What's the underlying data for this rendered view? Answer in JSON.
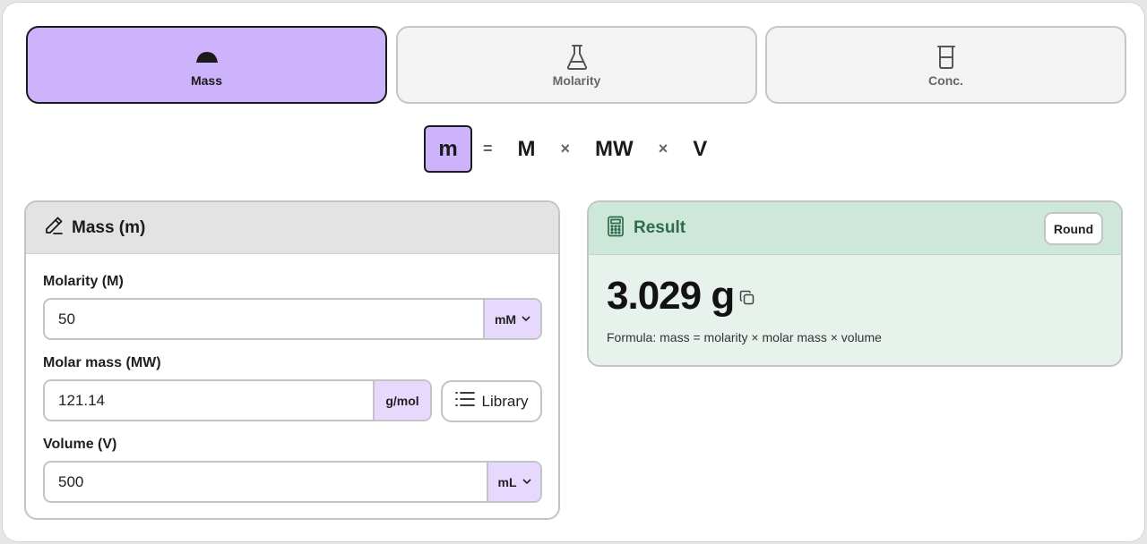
{
  "tabs": [
    {
      "label": "Mass",
      "icon": "mass-icon",
      "active": true
    },
    {
      "label": "Molarity",
      "icon": "flask-icon",
      "active": false
    },
    {
      "label": "Conc.",
      "icon": "beaker-icon",
      "active": false
    }
  ],
  "formula": {
    "lhs": "m",
    "eq": "=",
    "a": "M",
    "times1": "×",
    "b": "MW",
    "times2": "×",
    "c": "V"
  },
  "inputs": {
    "title": "Mass (m)",
    "molarity": {
      "label": "Molarity (M)",
      "value": "50",
      "unit": "mM"
    },
    "molar_mass": {
      "label": "Molar mass (MW)",
      "value": "121.14",
      "unit": "g/mol"
    },
    "library_label": "Library",
    "volume": {
      "label": "Volume (V)",
      "value": "500",
      "unit": "mL"
    }
  },
  "result": {
    "title": "Result",
    "round_label": "Round",
    "value": "3.029 g",
    "formula": "Formula: mass = molarity × molar mass × volume"
  },
  "colors": {
    "accent": "#cdb3fb",
    "unit_bg": "#e6d9fd",
    "result_bg": "#e8f2ec",
    "result_header": "#cde8db",
    "result_title": "#2f6b4a"
  }
}
